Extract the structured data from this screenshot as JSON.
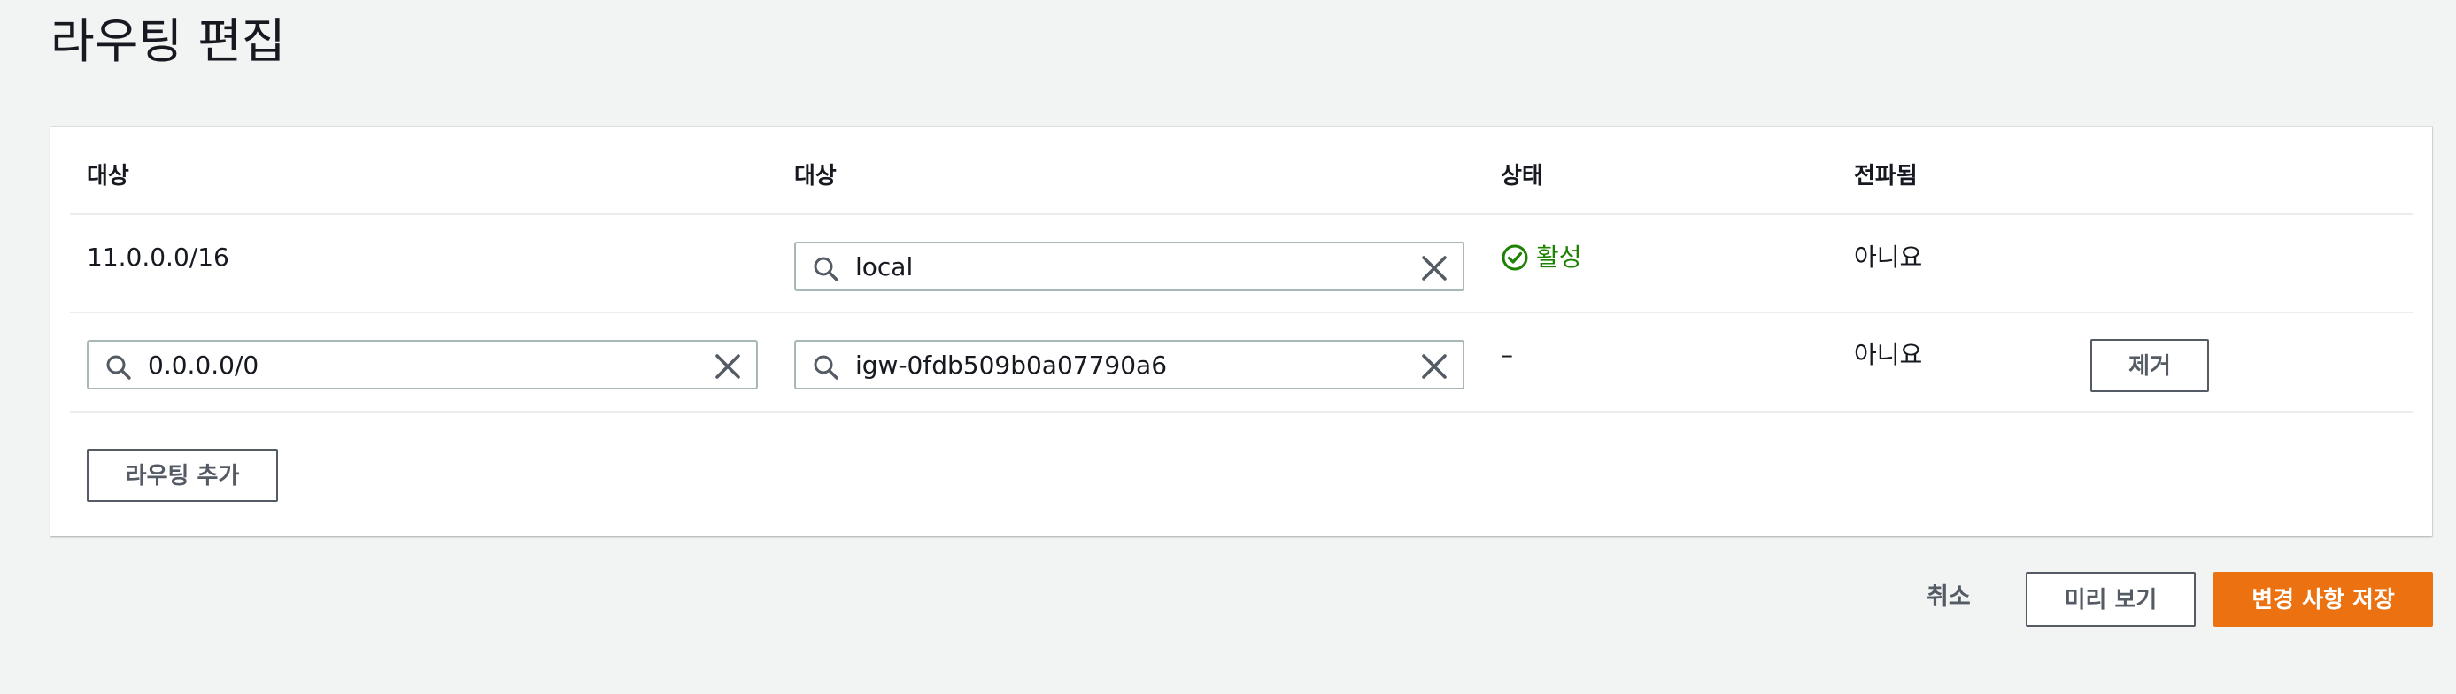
{
  "page": {
    "title": "라우팅 편집"
  },
  "table": {
    "headers": {
      "destination": "대상",
      "target": "대상",
      "status": "상태",
      "propagated": "전파됨"
    },
    "rows": [
      {
        "destination": "11.0.0.0/16",
        "target": "local",
        "status": "활성",
        "propagated": "아니요"
      },
      {
        "destination": "0.0.0.0/0",
        "target": "igw-0fdb509b0a07790a6",
        "status": "–",
        "propagated": "아니요",
        "remove_label": "제거"
      }
    ]
  },
  "actions": {
    "add_route": "라우팅 추가",
    "cancel": "취소",
    "preview": "미리 보기",
    "save": "변경 사항 저장"
  },
  "colors": {
    "accent": "#ec7211",
    "status_active": "#1d8102",
    "background": "#f2f3f3"
  },
  "icons": {
    "search": "search-icon",
    "clear": "close-icon",
    "status": "check-circle-icon"
  }
}
